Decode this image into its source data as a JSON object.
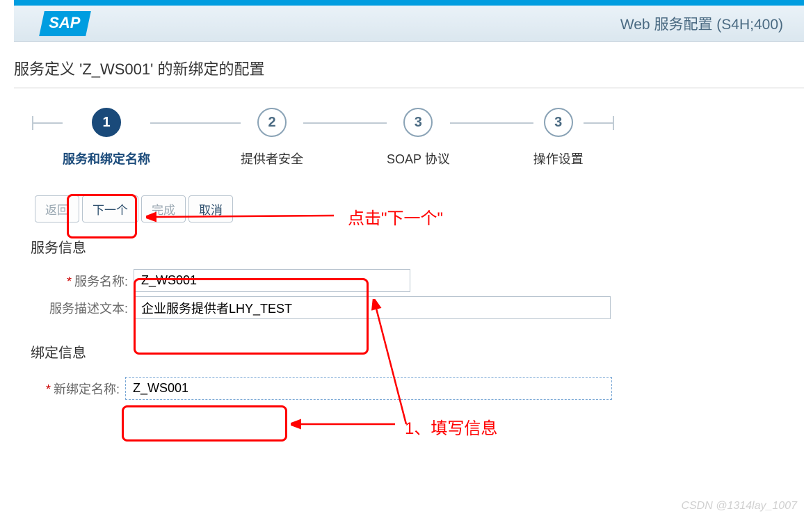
{
  "header": {
    "logo_text": "SAP",
    "title": "Web 服务配置 (S4H;400)"
  },
  "page_title": "服务定义 'Z_WS001' 的新绑定的配置",
  "wizard": {
    "steps": [
      {
        "num": "1",
        "label": "服务和绑定名称",
        "active": true
      },
      {
        "num": "2",
        "label": "提供者安全",
        "active": false
      },
      {
        "num": "3",
        "label": "SOAP 协议",
        "active": false
      },
      {
        "num": "3",
        "label": "操作设置",
        "active": false
      }
    ]
  },
  "buttons": {
    "back": "返回",
    "next": "下一个",
    "finish": "完成",
    "cancel": "取消"
  },
  "service_section": {
    "title": "服务信息",
    "name_label": "服务名称:",
    "name_value": "Z_WS001",
    "desc_label": "服务描述文本:",
    "desc_value": "企业服务提供者LHY_TEST"
  },
  "binding_section": {
    "title": "绑定信息",
    "name_label": "新绑定名称:",
    "name_value": "Z_WS001"
  },
  "annotations": {
    "click_next": "点击\"下一个\"",
    "fill_info": "1、填写信息"
  },
  "watermark": "CSDN @1314lay_1007"
}
